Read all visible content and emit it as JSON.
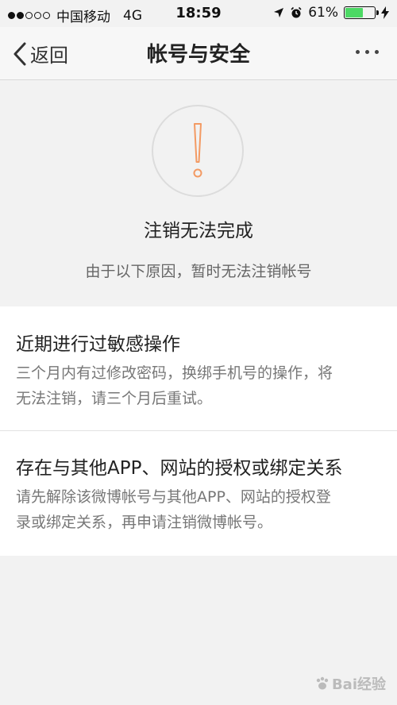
{
  "status_bar": {
    "carrier": "中国移动",
    "network": "4G",
    "time": "18:59",
    "battery_percent": "61%",
    "battery_level": 0.61,
    "signal_strength": 2,
    "signal_max": 5
  },
  "nav": {
    "back_label": "返回",
    "title": "帐号与安全"
  },
  "hero": {
    "title": "注销无法完成",
    "subtitle": "由于以下原因，暂时无法注销帐号",
    "icon_color": "#f39a63"
  },
  "reasons": [
    {
      "title": "近期进行过敏感操作",
      "desc_lines": [
        "三个月内有过修改密码，换绑手机号的操作，将",
        "无法注销，请三个月后重试。"
      ]
    },
    {
      "title": "存在与其他APP、网站的授权或绑定关系",
      "desc_lines": [
        "请先解除该微博帐号与其他APP、网站的授权登",
        "录或绑定关系，再申请注销微博帐号。"
      ]
    }
  ],
  "watermark": {
    "text": "Bai经验"
  }
}
